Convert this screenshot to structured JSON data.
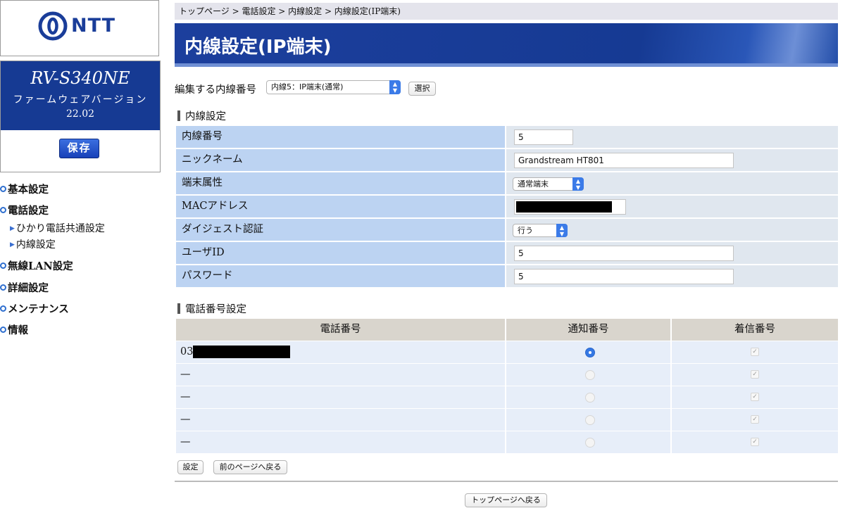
{
  "brand": {
    "logo_text": "NTT",
    "color": "#1a3d99"
  },
  "device": {
    "model": "RV-S340NE",
    "firmware_label": "ファームウェアバージョン",
    "firmware_version": "22.02",
    "save_label": "保存"
  },
  "nav": {
    "basic": "基本設定",
    "phone": "電話設定",
    "phone_common": "ひかり電話共通設定",
    "extension": "内線設定",
    "wlan": "無線LAN設定",
    "advanced": "詳細設定",
    "maintenance": "メンテナンス",
    "info": "情報"
  },
  "breadcrumb": "トップページ > 電話設定 > 内線設定 > 内線設定(IP端末)",
  "page_title": "内線設定(IP端末)",
  "editor": {
    "label": "編集する内線番号",
    "selected": "内線5：IP端末(通常)",
    "select_button": "選択"
  },
  "extension_settings": {
    "section_title": "内線設定",
    "number_label": "内線番号",
    "number_value": "5",
    "nickname_label": "ニックネーム",
    "nickname_value": "Grandstream HT801",
    "attribute_label": "端末属性",
    "attribute_value": "通常端末",
    "mac_label": "MACアドレス",
    "digest_label": "ダイジェスト認証",
    "digest_value": "行う",
    "userid_label": "ユーザID",
    "userid_value": "5",
    "password_label": "パスワード",
    "password_value": "5"
  },
  "phone_settings": {
    "section_title": "電話番号設定",
    "col_number": "電話番号",
    "col_notify": "通知番号",
    "col_incoming": "着信番号",
    "rows": [
      {
        "number": "03",
        "notify": true,
        "incoming": true
      },
      {
        "number": "—",
        "notify": false,
        "incoming": true
      },
      {
        "number": "—",
        "notify": false,
        "incoming": true
      },
      {
        "number": "—",
        "notify": false,
        "incoming": true
      },
      {
        "number": "—",
        "notify": false,
        "incoming": true
      }
    ]
  },
  "buttons": {
    "set": "設定",
    "back": "前のページへ戻る",
    "top": "トップページへ戻る"
  }
}
